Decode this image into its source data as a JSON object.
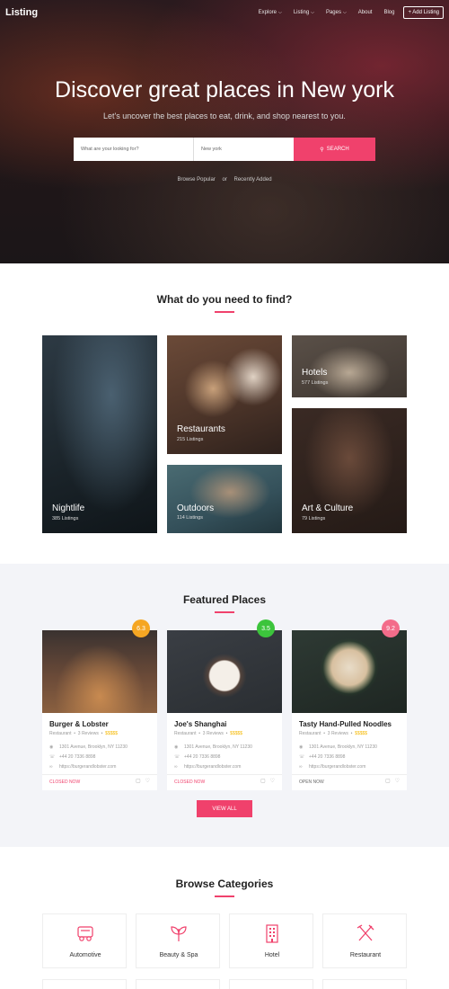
{
  "nav": {
    "brand": "Listing",
    "items": [
      "Explore",
      "Listing",
      "Pages",
      "About",
      "Blog"
    ],
    "add_label": "+ Add Listing"
  },
  "hero": {
    "title": "Discover great places in New york",
    "subtitle": "Let's uncover the best places to eat, drink, and shop nearest to you.",
    "what_placeholder": "What are your looking for?",
    "where_placeholder": "New york",
    "search_label": "SEARCH",
    "quick_a": "Browse Popular",
    "quick_sep": "or",
    "quick_b": "Recently Added"
  },
  "find": {
    "title": "What do you need to find?",
    "tiles": [
      {
        "name": "Nightlife",
        "count": "385 Listings"
      },
      {
        "name": "Restaurants",
        "count": "215 Listings"
      },
      {
        "name": "Outdoors",
        "count": "114 Listings"
      },
      {
        "name": "Hotels",
        "count": "577 Listings"
      },
      {
        "name": "Art & Culture",
        "count": "79 Listings"
      }
    ]
  },
  "featured": {
    "title": "Featured Places",
    "cards": [
      {
        "name": "Burger & Lobster",
        "type": "Restaurant",
        "reviews": "3 Reviews",
        "price": "$$$$$",
        "address": "1301 Avenue, Brooklyn, NY 11230",
        "phone": "+44 20 7336 8898",
        "url": "https://burgerandlobster.com",
        "status": "CLOSED NOW",
        "rating": "6.3"
      },
      {
        "name": "Joe's Shanghai",
        "type": "Restaurant",
        "reviews": "3 Reviews",
        "price": "$$$$$",
        "address": "1301 Avenue, Brooklyn, NY 11230",
        "phone": "+44 20 7336 8898",
        "url": "https://burgerandlobster.com",
        "status": "CLOSED NOW",
        "rating": "3.5"
      },
      {
        "name": "Tasty Hand-Pulled Noodles",
        "type": "Restaurant",
        "reviews": "3 Reviews",
        "price": "$$$$$",
        "address": "1301 Avenue, Brooklyn, NY 11230",
        "phone": "+44 20 7336 8898",
        "url": "https://burgerandlobster.com",
        "status": "OPEN NOW",
        "rating": "9.2"
      }
    ],
    "view_all": "VIEW ALL"
  },
  "categories": {
    "title": "Browse Categories",
    "items": [
      "Automotive",
      "Beauty & Spa",
      "Hotel",
      "Restaurant"
    ]
  },
  "colors": {
    "accent": "#f0416c",
    "badge_orange": "#f5a623",
    "badge_green": "#3cc43c",
    "badge_pink": "#f36c8a",
    "closed": "#f0416c",
    "open": "#666666"
  }
}
